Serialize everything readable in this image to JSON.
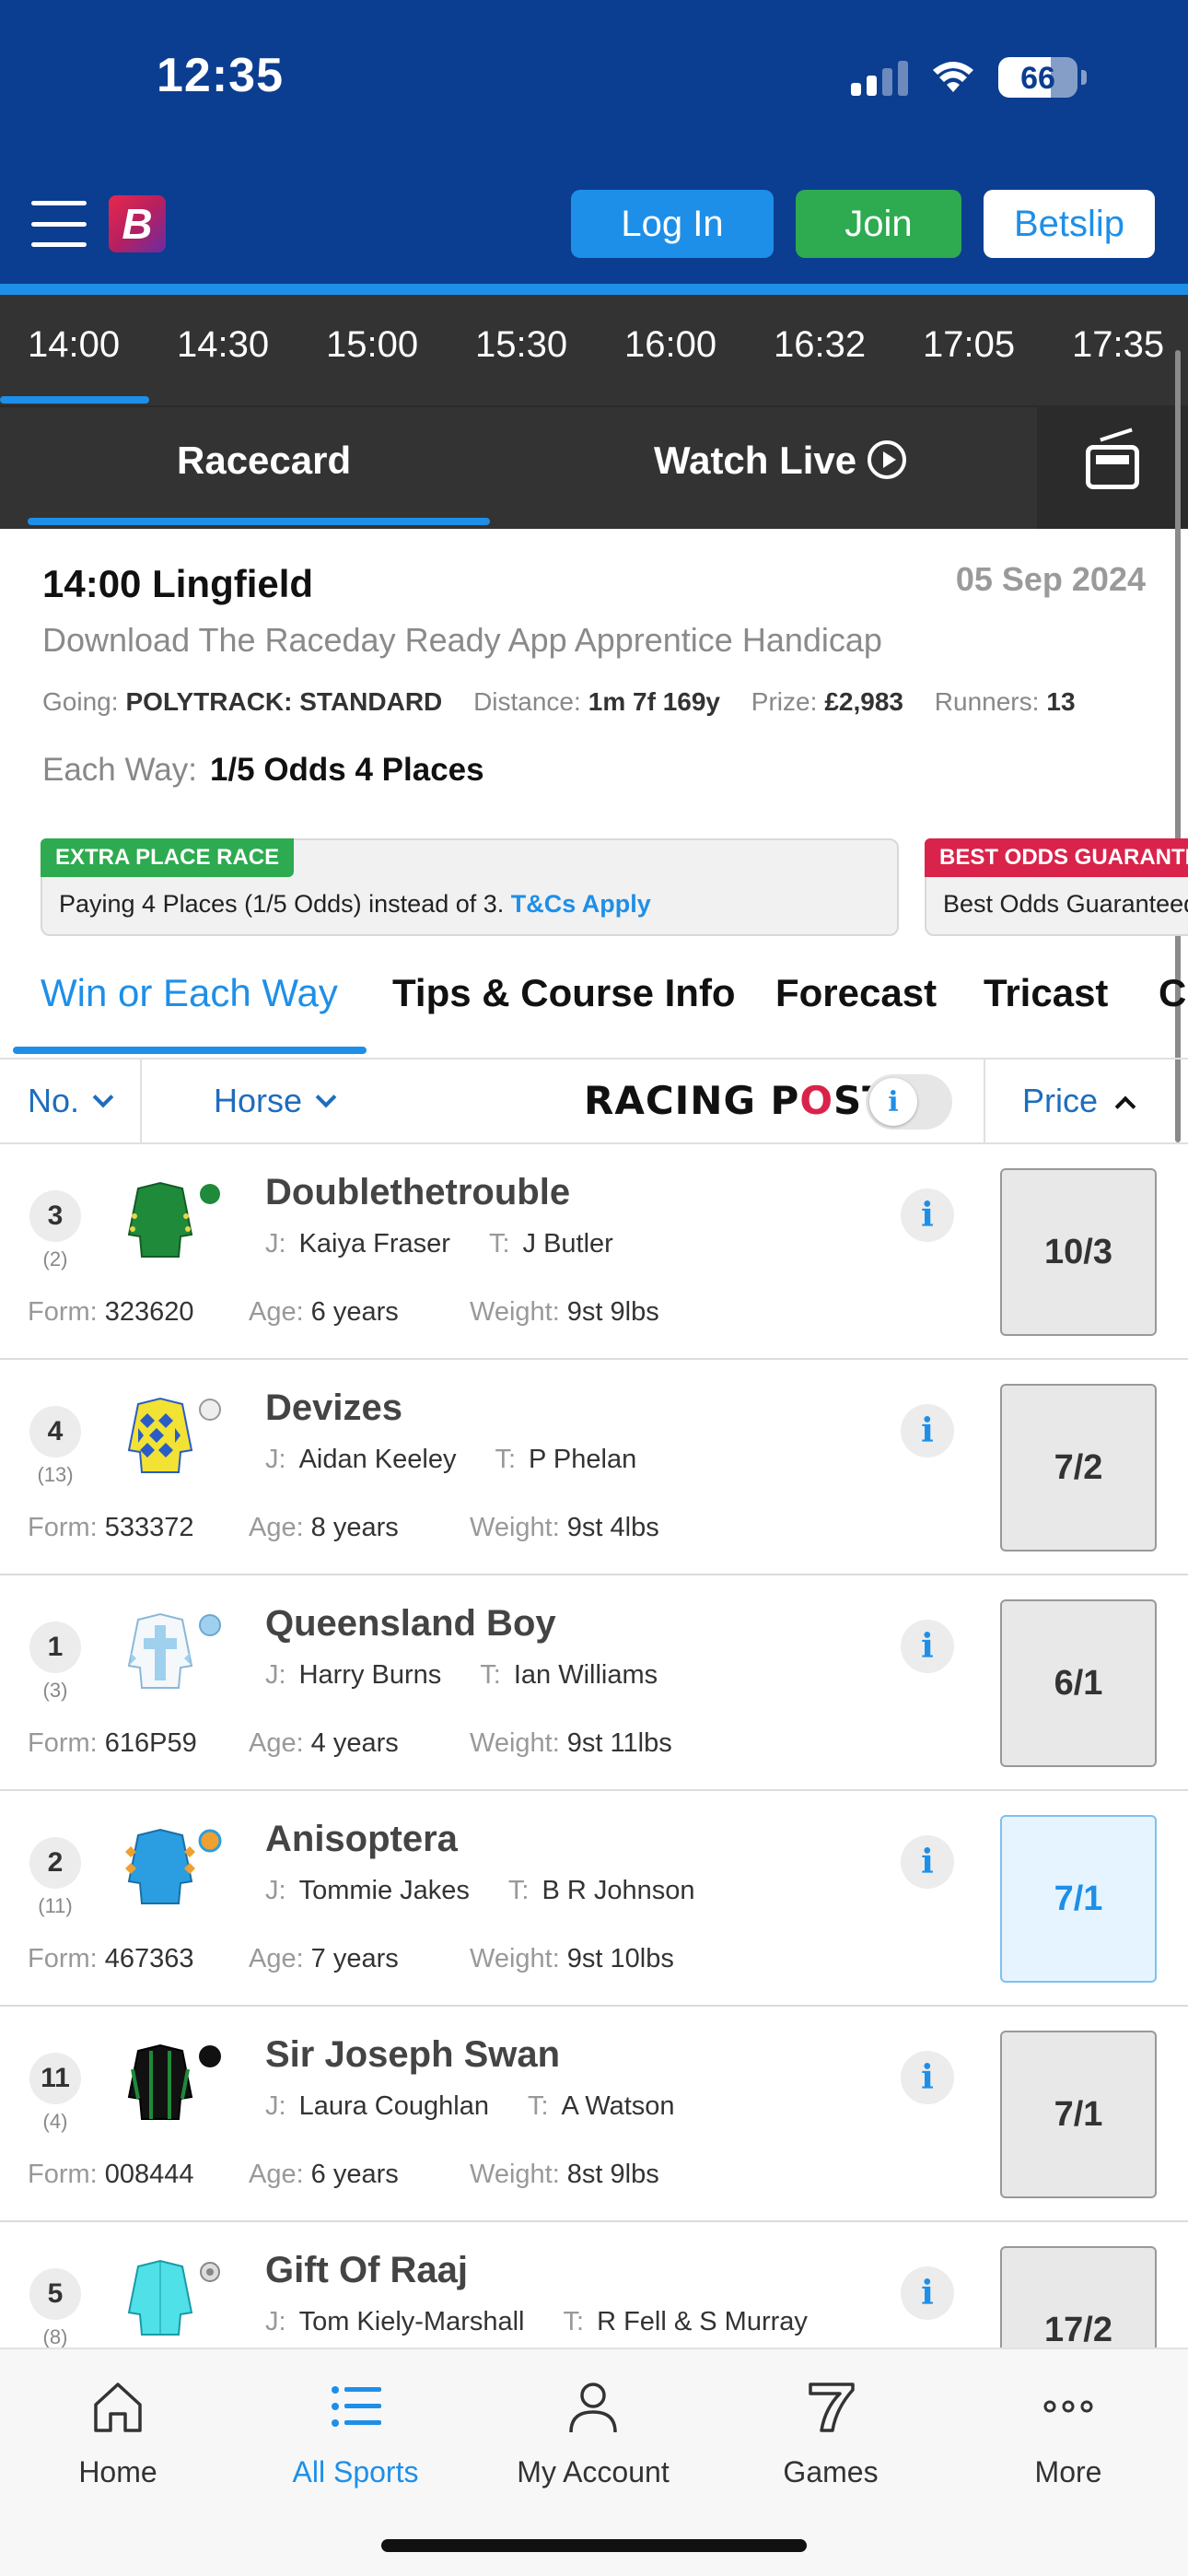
{
  "status_bar": {
    "time": "12:35",
    "battery": "66",
    "battery_level": 0.66
  },
  "header": {
    "logo_letter": "B",
    "login_label": "Log In",
    "join_label": "Join",
    "betslip_label": "Betslip"
  },
  "race_times": [
    "14:00",
    "14:30",
    "15:00",
    "15:30",
    "16:00",
    "16:32",
    "17:05",
    "17:35"
  ],
  "race_tabs": {
    "racecard": "Racecard",
    "watch_live": "Watch Live"
  },
  "race": {
    "title": "14:00 Lingfield",
    "date": "05 Sep 2024",
    "name": "Download The Raceday Ready App Apprentice Handicap",
    "going_label": "Going:",
    "going": "POLYTRACK: STANDARD",
    "distance_label": "Distance:",
    "distance": "1m 7f 169y",
    "prize_label": "Prize:",
    "prize": "£2,983",
    "runners_label": "Runners:",
    "runners": "13",
    "each_way_label": "Each Way:",
    "each_way": "1/5 Odds 4 Places"
  },
  "promos": [
    {
      "tag": "EXTRA PLACE RACE",
      "text": "Paying 4 Places (1/5 Odds) instead of 3.",
      "link": "T&Cs Apply"
    },
    {
      "tag": "BEST ODDS GUARANTEED",
      "text": "Best Odds Guaranteed"
    }
  ],
  "market_tabs": [
    "Win or Each Way",
    "Tips & Course Info",
    "Forecast",
    "Tricast",
    "C"
  ],
  "sort_bar": {
    "no": "No.",
    "horse": "Horse",
    "racing_post": "RACING POST",
    "price": "Price"
  },
  "labels": {
    "jockey": "J:",
    "trainer": "T:",
    "form": "Form:",
    "age": "Age:",
    "weight": "Weight:"
  },
  "runners": [
    {
      "num": "3",
      "draw": "(2)",
      "name": "Doublethetrouble",
      "jockey": "Kaiya Fraser",
      "trainer": "J Butler",
      "form": "323620",
      "age": "6 years",
      "weight": "9st 9lbs",
      "price": "10/3",
      "selected": false,
      "silks": "green"
    },
    {
      "num": "4",
      "draw": "(13)",
      "name": "Devizes",
      "jockey": "Aidan Keeley",
      "trainer": "P Phelan",
      "form": "533372",
      "age": "8 years",
      "weight": "9st 4lbs",
      "price": "7/2",
      "selected": false,
      "silks": "yellow-blue"
    },
    {
      "num": "1",
      "draw": "(3)",
      "name": "Queensland Boy",
      "jockey": "Harry Burns",
      "trainer": "Ian Williams",
      "form": "616P59",
      "age": "4 years",
      "weight": "9st 11lbs",
      "price": "6/1",
      "selected": false,
      "silks": "white-lightblue"
    },
    {
      "num": "2",
      "draw": "(11)",
      "name": "Anisoptera",
      "jockey": "Tommie Jakes",
      "trainer": "B R Johnson",
      "form": "467363",
      "age": "7 years",
      "weight": "9st 10lbs",
      "price": "7/1",
      "selected": true,
      "silks": "blue-orange"
    },
    {
      "num": "11",
      "draw": "(4)",
      "name": "Sir Joseph Swan",
      "jockey": "Laura Coughlan",
      "trainer": "A Watson",
      "form": "008444",
      "age": "6 years",
      "weight": "8st 9lbs",
      "price": "7/1",
      "selected": false,
      "silks": "black-green"
    },
    {
      "num": "5",
      "draw": "(8)",
      "name": "Gift Of Raaj",
      "jockey": "Tom Kiely-Marshall",
      "trainer": "R Fell & S Murray",
      "form": "",
      "age": "",
      "weight": "",
      "price": "17/2",
      "selected": false,
      "silks": "turquoise"
    }
  ],
  "bottom_nav": [
    {
      "label": "Home",
      "icon": "home-icon"
    },
    {
      "label": "All Sports",
      "icon": "list-icon",
      "active": true
    },
    {
      "label": "My Account",
      "icon": "person-icon"
    },
    {
      "label": "Games",
      "icon": "slot-seven-icon"
    },
    {
      "label": "More",
      "icon": "more-dots-icon"
    }
  ],
  "colors": {
    "brand_blue": "#0b3d91",
    "accent_blue": "#1e8fe8",
    "join_green": "#2eaa50",
    "dark_bar": "#333333"
  }
}
